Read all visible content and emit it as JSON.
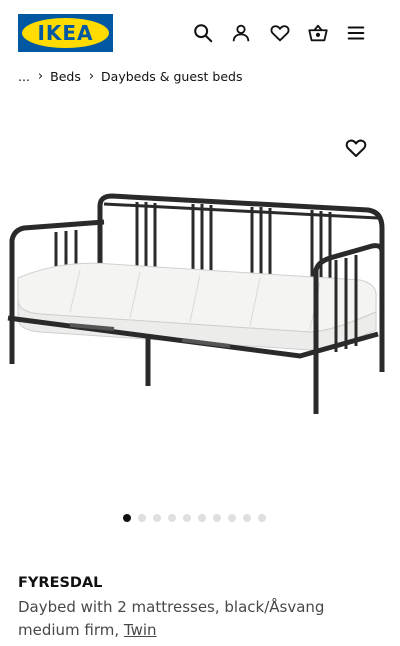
{
  "header": {
    "logo_text": "IKEA",
    "icons": [
      "search-icon",
      "account-icon",
      "heart-icon",
      "shopping-bag-icon",
      "menu-icon"
    ]
  },
  "breadcrumb": {
    "ellipsis": "...",
    "items": [
      "Beds",
      "Daybeds & guest beds"
    ],
    "separator": "›"
  },
  "gallery": {
    "image_subject": "Black metal daybed with white mattresses",
    "favorite_icon": "heart-icon",
    "dot_count": 10,
    "active_dot": 1
  },
  "product": {
    "name": "FYRESDAL",
    "description": "Daybed with 2 mattresses, black/Åsvang medium firm, ",
    "size_link": "Twin"
  },
  "colors": {
    "brand_blue": "#0058a3",
    "brand_yellow": "#ffdb00",
    "text": "#111111",
    "secondary_text": "#484848"
  }
}
